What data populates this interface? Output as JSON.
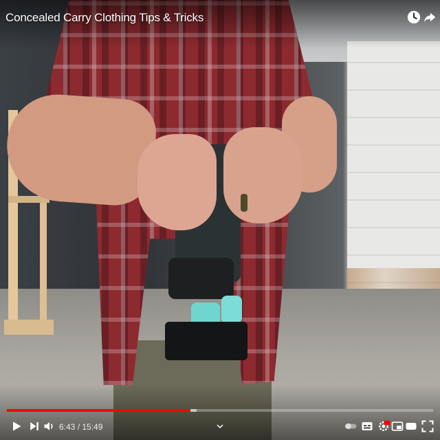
{
  "video": {
    "title": "Concealed Carry Clothing Tips & Tricks"
  },
  "header": {
    "watch_later_icon": "clock-icon",
    "share_icon": "share-arrow-icon"
  },
  "progress": {
    "played_fraction": 0.43,
    "buffered_fraction": 0.445
  },
  "controls": {
    "current_time": "6:43",
    "separator": "/",
    "duration": "15:49",
    "time_text": "6:43 / 15:49",
    "icons": [
      "play-icon",
      "next-icon",
      "volume-icon",
      "chevron-up-icon",
      "autoplay-toggle-icon",
      "subtitles-icon",
      "settings-icon",
      "miniplayer-icon",
      "theater-icon",
      "fullscreen-icon"
    ],
    "settings_badge": "HD"
  },
  "colors": {
    "accent": "#ff0000",
    "control_text": "#eeeeee"
  }
}
